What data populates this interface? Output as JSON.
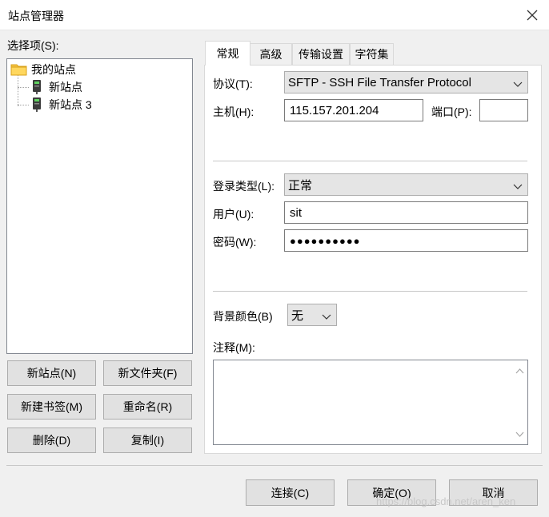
{
  "window": {
    "title": "站点管理器"
  },
  "left": {
    "select_label": "选择项(S):",
    "tree": [
      {
        "label": "我的站点",
        "icon": "folder-icon"
      },
      {
        "label": "新站点",
        "icon": "server-icon"
      },
      {
        "label": "新站点 3",
        "icon": "server-icon"
      }
    ],
    "buttons": {
      "new_site": "新站点(N)",
      "new_folder": "新文件夹(F)",
      "new_bookmark": "新建书签(M)",
      "rename": "重命名(R)",
      "delete": "删除(D)",
      "copy": "复制(I)"
    }
  },
  "tabs": [
    {
      "label": "常规",
      "active": true
    },
    {
      "label": "高级",
      "active": false
    },
    {
      "label": "传输设置",
      "active": false
    },
    {
      "label": "字符集",
      "active": false
    }
  ],
  "general": {
    "protocol_label": "协议(T):",
    "protocol_value": "SFTP - SSH File Transfer Protocol",
    "host_label": "主机(H):",
    "host_value": "115.157.201.204",
    "port_label": "端口(P):",
    "port_value": "",
    "login_type_label": "登录类型(L):",
    "login_type_value": "正常",
    "user_label": "用户(U):",
    "user_value": "sit",
    "password_label": "密码(W):",
    "password_value": "●●●●●●●●●●",
    "bg_color_label": "背景颜色(B)",
    "bg_color_value": "无",
    "comment_label": "注释(M):",
    "comment_value": ""
  },
  "footer": {
    "connect": "连接(C)",
    "ok": "确定(O)",
    "cancel": "取消",
    "watermark": "https://blog.csdn.net/aren_ken"
  }
}
